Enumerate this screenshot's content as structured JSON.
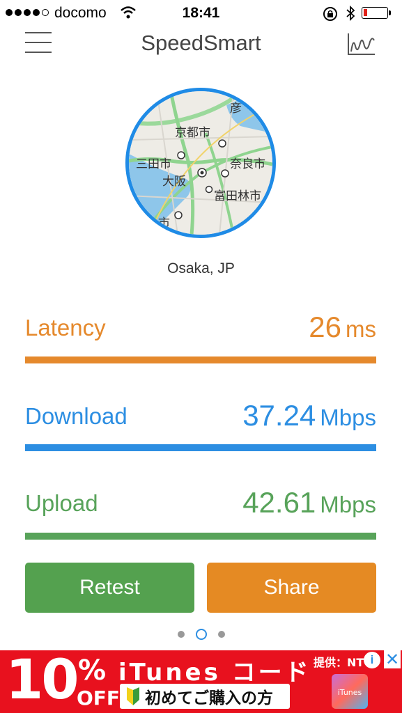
{
  "status_bar": {
    "carrier": "docomo",
    "time": "18:41",
    "signal_bars": 4,
    "signal_total": 5,
    "battery_level": 0.15
  },
  "header": {
    "title": "SpeedSmart",
    "menu_icon": "hamburger-menu-icon",
    "history_icon": "graph-history-icon"
  },
  "map": {
    "labels": [
      "彦",
      "京都市",
      "三田市",
      "奈良市",
      "大阪",
      "富田林市",
      "市"
    ]
  },
  "location": "Osaka, JP",
  "metrics": {
    "latency": {
      "label": "Latency",
      "value": "26",
      "unit": "ms",
      "color": "#e5892c"
    },
    "download": {
      "label": "Download",
      "value": "37.24",
      "unit": "Mbps",
      "color": "#2c8ee2"
    },
    "upload": {
      "label": "Upload",
      "value": "42.61",
      "unit": "Mbps",
      "color": "#58a35a"
    }
  },
  "buttons": {
    "retest": "Retest",
    "share": "Share"
  },
  "pager": {
    "pages": 3,
    "active": 1
  },
  "ad": {
    "percent": "10",
    "percent_sign": "%",
    "off": "OFF",
    "title": "iTunes コード",
    "subtitle": "初めてご購入の方",
    "provider": "提供：NT",
    "badge": "iTunes",
    "background": "#e8111e"
  }
}
